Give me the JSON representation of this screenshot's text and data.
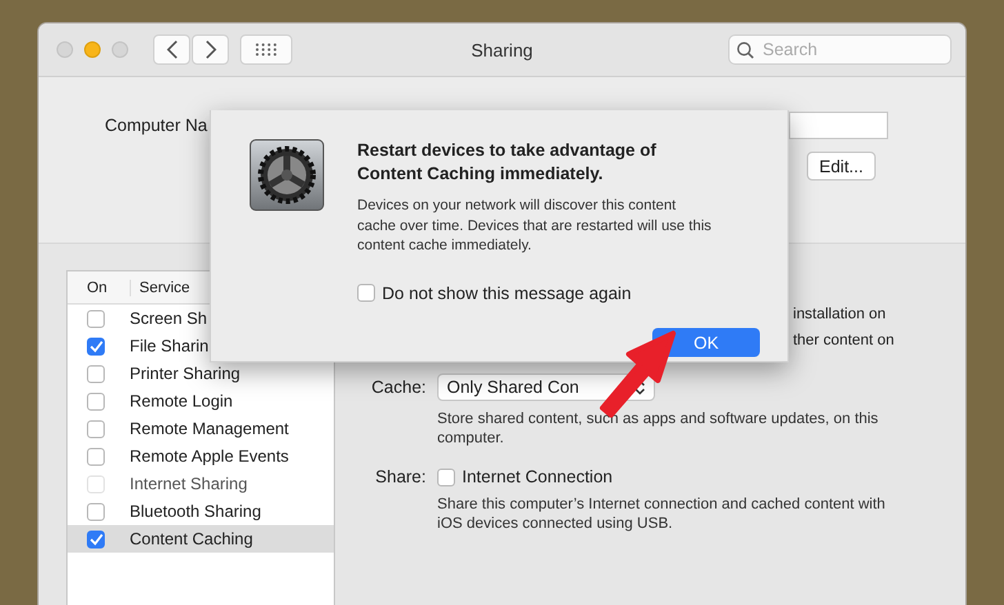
{
  "window": {
    "title": "Sharing",
    "search": {
      "placeholder": "Search"
    }
  },
  "computer_name": {
    "label": "Computer Na",
    "edit_button": "Edit..."
  },
  "services": {
    "columns": [
      "On",
      "Service"
    ],
    "items": [
      {
        "name": "Screen Sh",
        "checked": false,
        "disabled": false,
        "selected": false
      },
      {
        "name": "File Sharin",
        "checked": true,
        "disabled": false,
        "selected": false
      },
      {
        "name": "Printer Sharing",
        "checked": false,
        "disabled": false,
        "selected": false
      },
      {
        "name": "Remote Login",
        "checked": false,
        "disabled": false,
        "selected": false
      },
      {
        "name": "Remote Management",
        "checked": false,
        "disabled": false,
        "selected": false
      },
      {
        "name": "Remote Apple Events",
        "checked": false,
        "disabled": false,
        "selected": false
      },
      {
        "name": "Internet Sharing",
        "checked": false,
        "disabled": true,
        "selected": false
      },
      {
        "name": "Bluetooth Sharing",
        "checked": false,
        "disabled": false,
        "selected": false
      },
      {
        "name": "Content Caching",
        "checked": true,
        "disabled": false,
        "selected": true
      }
    ]
  },
  "detail": {
    "partial_lines": [
      "installation on",
      "ther content on"
    ],
    "cache": {
      "label": "Cache:",
      "value": "Only Shared Con",
      "description": "Store shared content, such as apps and software updates, on this computer."
    },
    "share": {
      "label": "Share:",
      "option": "Internet Connection",
      "checked": false,
      "description": "Share this computer’s Internet connection and cached content with iOS devices connected using USB."
    }
  },
  "dialog": {
    "title": "Restart devices to take advantage of Content Caching immediately.",
    "message": "Devices on your network will discover this content cache over time. Devices that are restarted will use this content cache immediately.",
    "checkbox": {
      "label": "Do not show this message again",
      "checked": false
    },
    "button": "OK"
  }
}
